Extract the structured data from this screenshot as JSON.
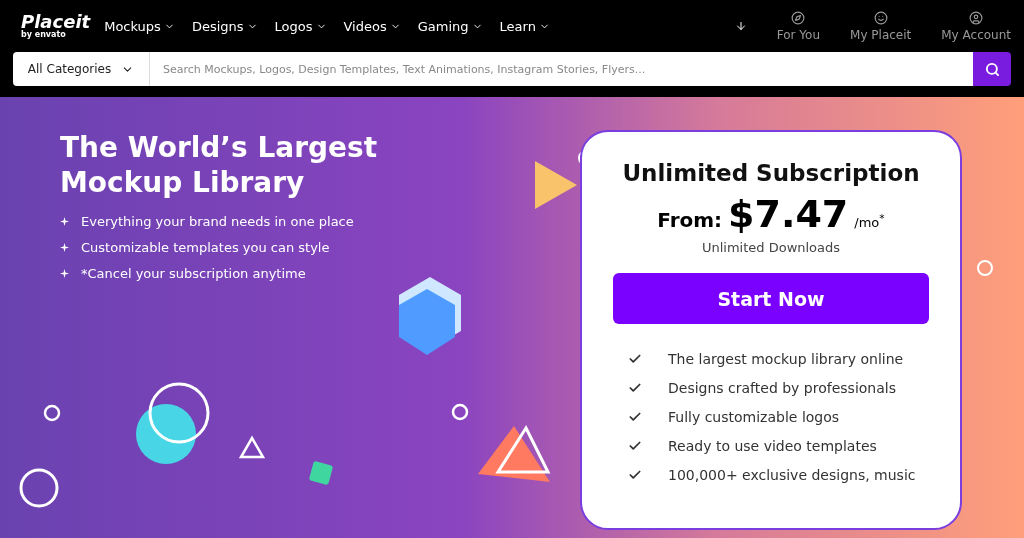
{
  "logo": {
    "name": "Placeit",
    "byline": "by envato"
  },
  "nav": [
    {
      "label": "Mockups"
    },
    {
      "label": "Designs"
    },
    {
      "label": "Logos"
    },
    {
      "label": "Videos"
    },
    {
      "label": "Gaming"
    },
    {
      "label": "Learn"
    }
  ],
  "account_links": [
    {
      "label": "For You",
      "kind": "compass"
    },
    {
      "label": "My Placeit",
      "kind": "smile"
    },
    {
      "label": "My Account",
      "kind": "user"
    }
  ],
  "search": {
    "category": "All Categories",
    "placeholder": "Search Mockups, Logos, Design Templates, Text Animations, Instagram Stories, Flyers..."
  },
  "hero": {
    "title": "The World’s Largest Mockup Library",
    "bullets": [
      "Everything your brand needs in one place",
      "Customizable templates you can style",
      "*Cancel your subscription anytime"
    ]
  },
  "pricing_card": {
    "title": "Unlimited Subscription",
    "from_label": "From:",
    "price": "$7.47",
    "unit": "/mo$^{*}$",
    "subtitle": "Unlimited Downloads",
    "button": "Start Now",
    "features": [
      "The largest mockup library online",
      "Designs crafted by professionals",
      "Fully customizable logos",
      "Ready to use video templates",
      "100,000+ exclusive designs, music"
    ]
  }
}
